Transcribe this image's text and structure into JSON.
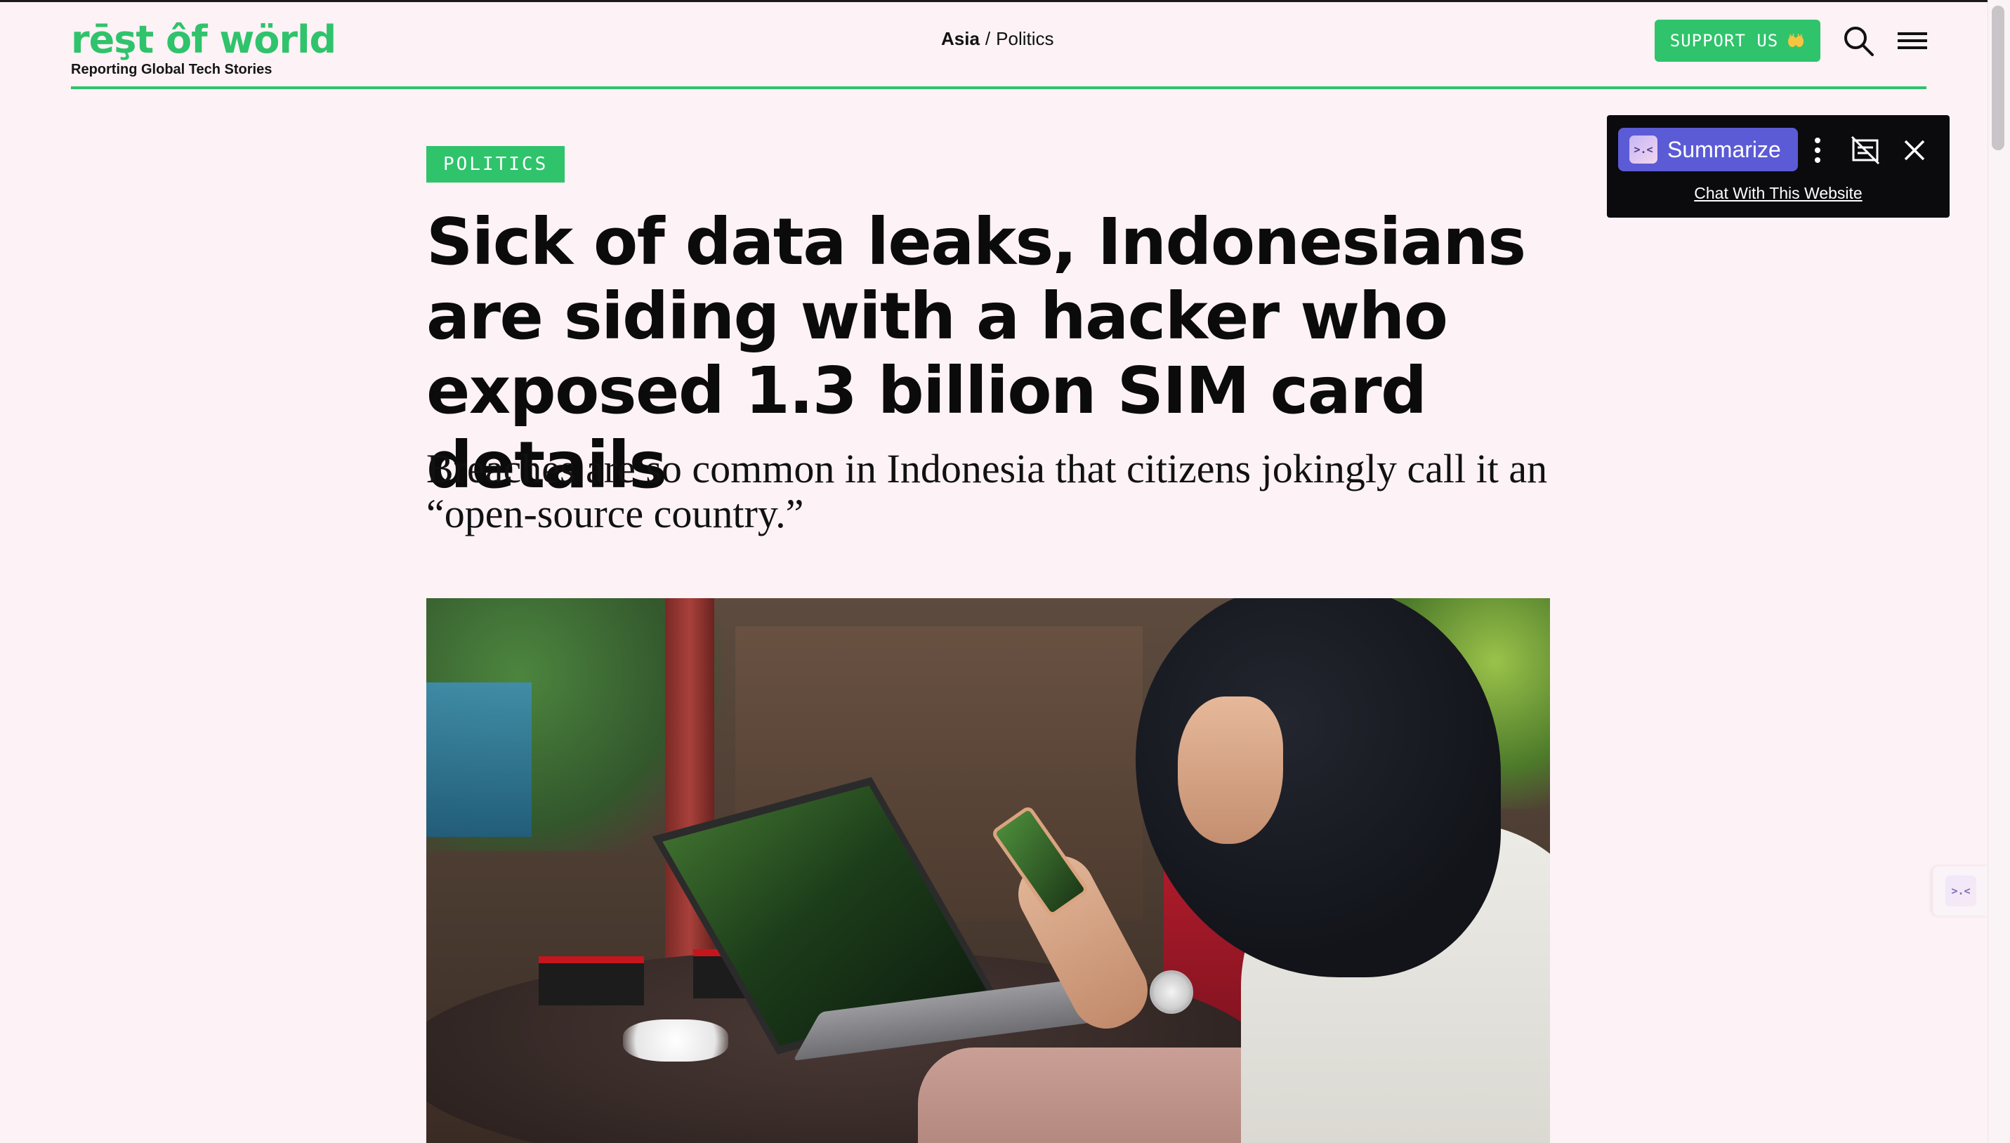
{
  "site": {
    "logo_text": "rēşt ôf wörld",
    "tagline": "Reporting Global Tech Stories"
  },
  "header": {
    "breadcrumb": {
      "region": "Asia",
      "separator": "/",
      "section": "Politics"
    },
    "support_label": "SUPPORT US",
    "support_icon": "clapping-hands-icon",
    "search_icon": "search-icon",
    "menu_icon": "hamburger-menu-icon"
  },
  "article": {
    "category": "POLITICS",
    "headline": "Sick of data leaks, Indonesians are siding with a hacker who exposed 1.3 billion SIM card details",
    "dek": "Breaches are so common in Indonesia that citizens jokingly call it an “open-source country.”"
  },
  "extension": {
    "summarize_label": "Summarize",
    "logo_glyph": ">.<",
    "chat_link": "Chat With This Website",
    "more_icon": "more-vertical-icon",
    "hide_icon": "hide-panel-icon",
    "close_icon": "close-icon"
  },
  "colors": {
    "brand_green": "#2fc36b",
    "page_background": "#fdf2f6",
    "extension_panel": "#0b0b0e",
    "extension_button": "#5b5bd6"
  }
}
